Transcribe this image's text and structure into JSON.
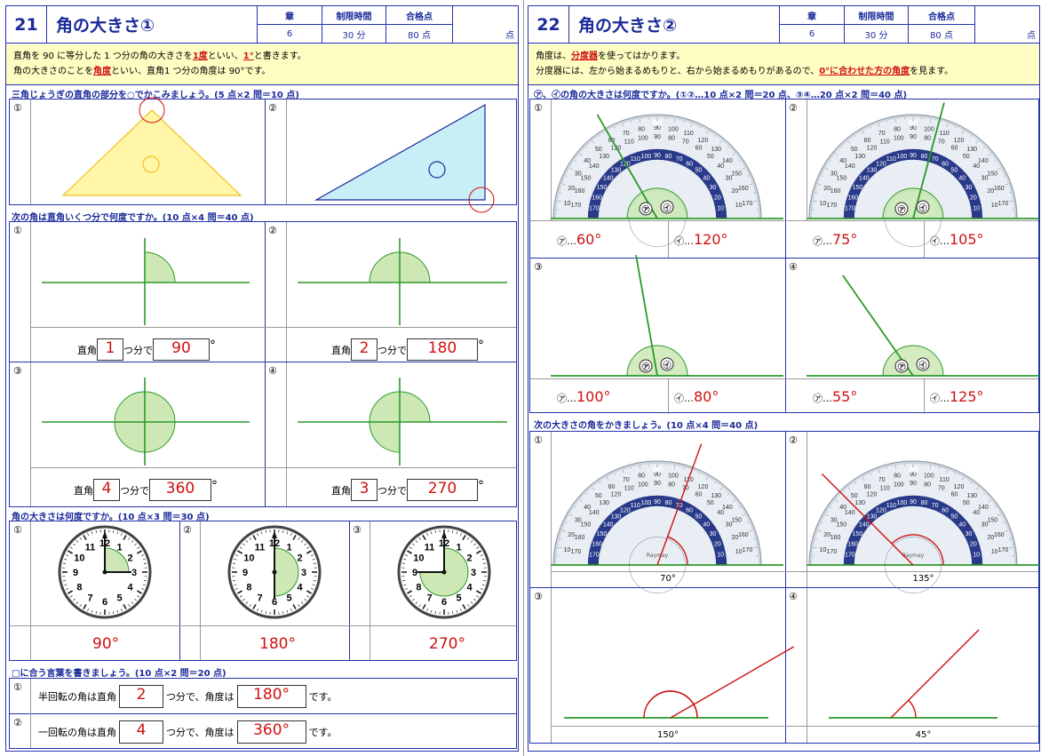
{
  "p21": {
    "num": "21",
    "title": "角の大きさ①",
    "h1": "章",
    "v1": "6",
    "h2": "制限時間",
    "v2": "30 分",
    "h3": "合格点",
    "v3": "80 点",
    "score_unit": "点",
    "intro1_a": "直角を 90 に等分した 1 つ分の角の大きさを",
    "intro1_b": "1度",
    "intro1_c": "といい、",
    "intro1_d": "1°",
    "intro1_e": "と書きます。",
    "intro2_a": "角の大きさのことを",
    "intro2_b": "角度",
    "intro2_c": "といい、直角1 つ分の角度は 90°です。",
    "s1": "三角じょうぎの直角の部分を○でかこみましょう。(5 点×2 問＝10 点)",
    "s2": "次の角は直角いくつ分で何度ですか。(10 点×4 問＝40 点)",
    "s3": "角の大きさは何度ですか。(10 点×3 問＝30 点)",
    "s4": "□に合う言葉を書きましょう。(10 点×2 問＝20 点)",
    "m1": "①",
    "m2": "②",
    "m3": "③",
    "m4": "④",
    "right_angle": "直角",
    "tsubun": "つ分で",
    "deg": "°",
    "q2": [
      {
        "n": "1",
        "d": "90"
      },
      {
        "n": "2",
        "d": "180"
      },
      {
        "n": "4",
        "d": "360"
      },
      {
        "n": "3",
        "d": "270"
      }
    ],
    "q3": [
      "90°",
      "180°",
      "270°"
    ],
    "clock": [
      "12",
      "1",
      "2",
      "3",
      "4",
      "5",
      "6",
      "7",
      "8",
      "9",
      "10",
      "11"
    ],
    "q4_1a": "半回転の角は直角",
    "q4_1n": "2",
    "q4_1b": "つ分で、角度は",
    "q4_1d": "180°",
    "q4_1c": "です。",
    "q4_2a": "一回転の角は直角",
    "q4_2n": "4",
    "q4_2b": "つ分で、角度は",
    "q4_2d": "360°",
    "q4_2c": "です。"
  },
  "p22": {
    "num": "22",
    "title": "角の大きさ②",
    "h1": "章",
    "v1": "6",
    "h2": "制限時間",
    "v2": "30 分",
    "h3": "合格点",
    "v3": "80 点",
    "score_unit": "点",
    "intro1_a": "角度は、",
    "intro1_b": "分度器",
    "intro1_c": "を使ってはかります。",
    "intro2_a": "分度器には、左から始まるめもりと、右から始まるめもりがあるので、",
    "intro2_b": "0°に合わせた方の角度",
    "intro2_c": "を見ます。",
    "s1": "㋐、㋑の角の大きさは何度ですか。(①②…10 点×2 問＝20 点、③④…20 点×2 問＝40 点)",
    "s2": "次の大きさの角をかきましょう。(10 点×4 問＝40 点)",
    "m1": "①",
    "m2": "②",
    "m3": "③",
    "m4": "④",
    "ka": "㋐",
    "ki": "㋑",
    "dots": "…",
    "q1": [
      {
        "a": "60°",
        "b": "120°"
      },
      {
        "a": "75°",
        "b": "105°"
      },
      {
        "a": "100°",
        "b": "80°"
      },
      {
        "a": "55°",
        "b": "125°"
      }
    ],
    "q2": [
      "70°",
      "135°",
      "150°",
      "45°"
    ],
    "brand": "Raymay"
  },
  "colors": {
    "blue": "#1a2a9a",
    "red": "#d01010",
    "green": "#2a9a2a",
    "yellow": "#fefdc2"
  }
}
